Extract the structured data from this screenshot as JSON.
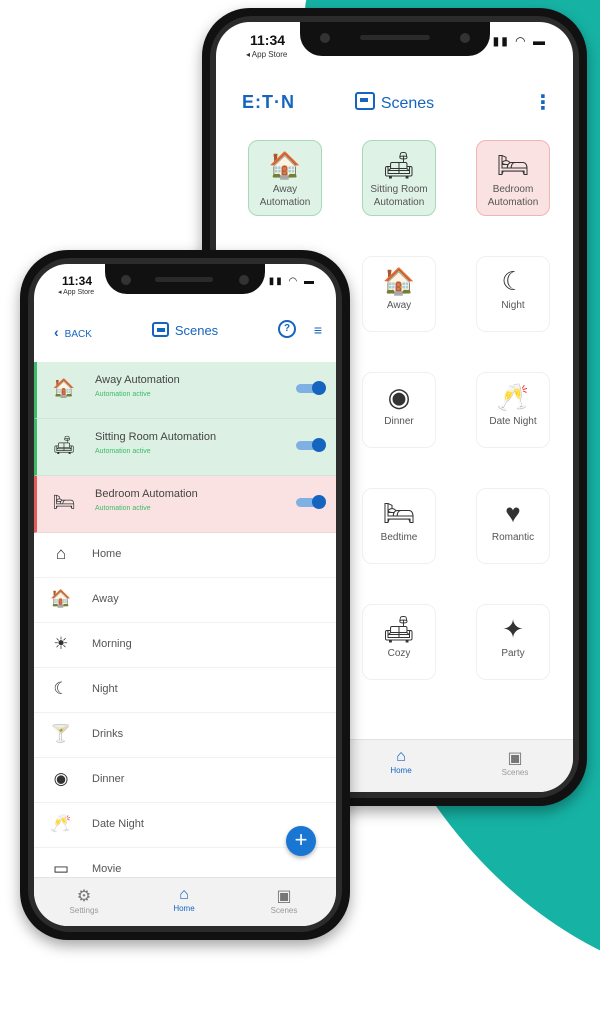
{
  "colors": {
    "accent": "#1565c0",
    "teal": "#16b3a5",
    "active_green": "#3dbb6a",
    "alert_red": "#e35b5b"
  },
  "back_phone": {
    "status": {
      "time": "11:34",
      "sub": "◂ App Store"
    },
    "logo": "E:T·N",
    "title": "Scenes",
    "tiles": [
      {
        "label": "Away Automation",
        "icon": "house-arrow-icon",
        "glyph": "🏠",
        "style": "green"
      },
      {
        "label": "Sitting Room Automation",
        "icon": "sofa-lamps-icon",
        "glyph": "🛋",
        "style": "green"
      },
      {
        "label": "Bedroom Automation",
        "icon": "bed-icon",
        "glyph": "🛏",
        "style": "red"
      },
      {
        "label": "Away",
        "icon": "house-arrow-icon",
        "glyph": "🏠",
        "style": "plain"
      },
      {
        "label": "Night",
        "icon": "moon-icon",
        "glyph": "☾",
        "style": "plain"
      },
      {
        "label": "Dinner",
        "icon": "plate-icon",
        "glyph": "◉",
        "style": "plain"
      },
      {
        "label": "Date Night",
        "icon": "glasses-icon",
        "glyph": "🥂",
        "style": "plain"
      },
      {
        "label": "Bedtime",
        "icon": "bed-icon",
        "glyph": "🛏",
        "style": "plain"
      },
      {
        "label": "Romantic",
        "icon": "table-icon",
        "glyph": "♥",
        "style": "plain"
      },
      {
        "label": "Cozy",
        "icon": "sofa-icon",
        "glyph": "🛋",
        "style": "plain"
      },
      {
        "label": "Party",
        "icon": "dancer-icon",
        "glyph": "✦",
        "style": "plain"
      }
    ],
    "tabs": [
      {
        "label": "Home",
        "glyph": "⌂",
        "active": true
      },
      {
        "label": "Scenes",
        "glyph": "▣",
        "active": false
      }
    ]
  },
  "front_phone": {
    "status": {
      "time": "11:34",
      "sub": "◂ App Store"
    },
    "back_label": "BACK",
    "title": "Scenes",
    "help_glyph": "?",
    "automations": [
      {
        "name": "Away Automation",
        "status": "Automation active",
        "style": "green",
        "glyph": "🏠"
      },
      {
        "name": "Sitting Room Automation",
        "status": "Automation active",
        "style": "green",
        "glyph": "🛋"
      },
      {
        "name": "Bedroom Automation",
        "status": "Automation active",
        "style": "red",
        "glyph": "🛏"
      }
    ],
    "scenes": [
      {
        "name": "Home",
        "glyph": "⌂"
      },
      {
        "name": "Away",
        "glyph": "🏠"
      },
      {
        "name": "Morning",
        "glyph": "☀"
      },
      {
        "name": "Night",
        "glyph": "☾"
      },
      {
        "name": "Drinks",
        "glyph": "🍸"
      },
      {
        "name": "Dinner",
        "glyph": "◉"
      },
      {
        "name": "Date Night",
        "glyph": "🥂"
      },
      {
        "name": "Movie",
        "glyph": "▭"
      }
    ],
    "fab": "+",
    "tabs": [
      {
        "label": "Settings",
        "glyph": "⚙",
        "active": false
      },
      {
        "label": "Home",
        "glyph": "⌂",
        "active": true
      },
      {
        "label": "Scenes",
        "glyph": "▣",
        "active": false
      }
    ]
  }
}
